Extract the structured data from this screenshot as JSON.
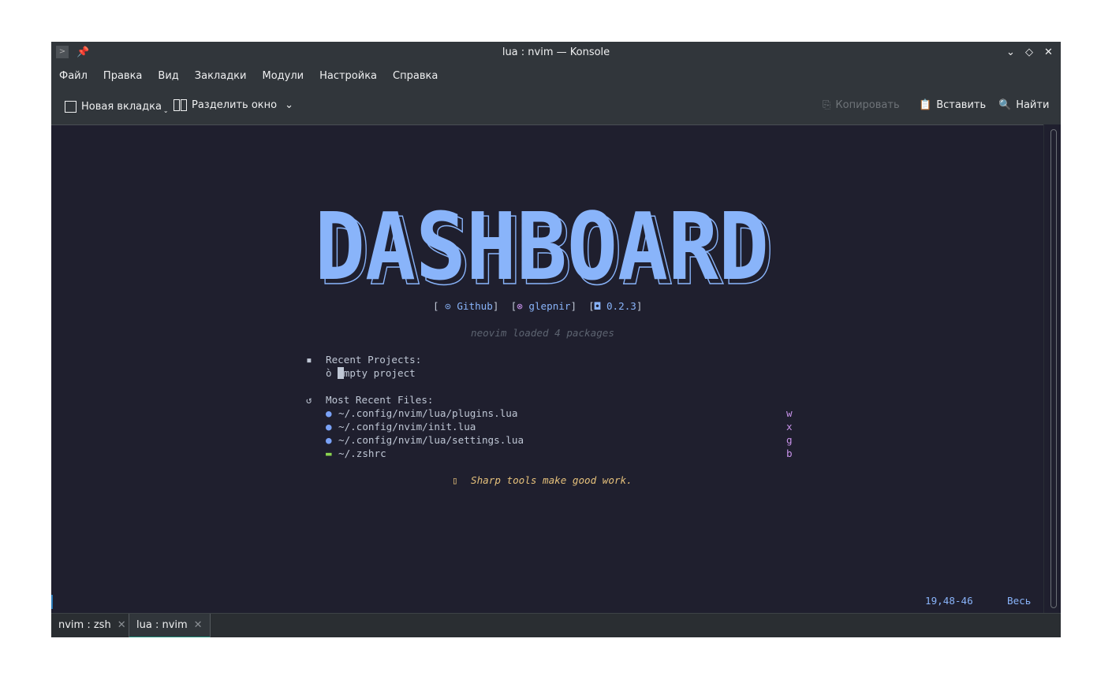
{
  "window": {
    "title": "lua : nvim — Konsole"
  },
  "menu": [
    "Файл",
    "Правка",
    "Вид",
    "Закладки",
    "Модули",
    "Настройка",
    "Справка"
  ],
  "toolbar": {
    "new_tab": "Новая вкладка",
    "split": "Разделить окно",
    "copy": "Копировать",
    "paste": "Вставить",
    "find": "Найти"
  },
  "dashboard": {
    "logo": "DASHBOARD",
    "links": {
      "github": "Github",
      "author": "glepnir",
      "version": "0.2.3"
    },
    "loaded": "neovim loaded 4 packages",
    "recent_projects_title": "Recent Projects:",
    "projects": [
      {
        "icon": "ò",
        "name": "empty project"
      }
    ],
    "recent_files_title": "Most Recent Files:",
    "files": [
      {
        "path": "~/.config/nvim/lua/plugins.lua",
        "key": "w",
        "type": "lua"
      },
      {
        "path": "~/.config/nvim/init.lua",
        "key": "x",
        "type": "lua"
      },
      {
        "path": "~/.config/nvim/lua/settings.lua",
        "key": "g",
        "type": "lua"
      },
      {
        "path": "~/.zshrc",
        "key": "b",
        "type": "shell"
      }
    ],
    "footer": "Sharp tools make good work."
  },
  "statusline": {
    "position": "19,48-46",
    "scroll": "Весь"
  },
  "tabs": [
    {
      "label": "nvim : zsh",
      "active": false
    },
    {
      "label": "lua : nvim",
      "active": true
    }
  ],
  "colors": {
    "logo": "#89b4fa",
    "terminal_bg": "#1f1f2e",
    "chrome": "#31363b",
    "tab_accent": "#1d8a76"
  }
}
